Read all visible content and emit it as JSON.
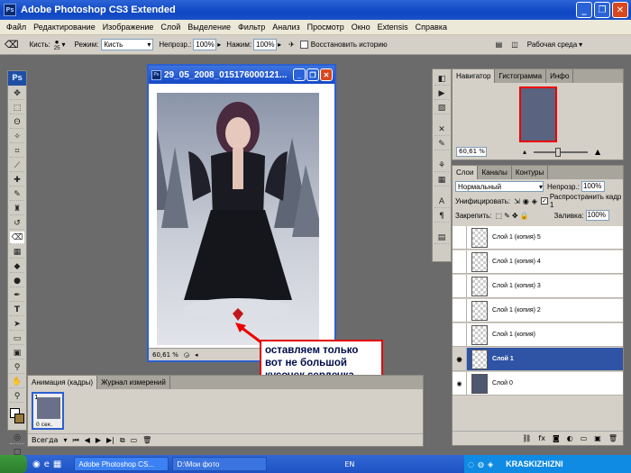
{
  "app": {
    "title": "Adobe Photoshop CS3 Extended"
  },
  "menu": [
    "Файл",
    "Редактирование",
    "Изображение",
    "Слой",
    "Выделение",
    "Фильтр",
    "Анализ",
    "Просмотр",
    "Окно",
    "Extensis",
    "Справка"
  ],
  "options": {
    "brush_label": "Кисть:",
    "brush_size": "25",
    "mode_label": "Режим:",
    "mode_value": "Кисть",
    "opacity_label": "Непрозр.:",
    "opacity_value": "100%",
    "pressure_label": "Нажим:",
    "pressure_value": "100%",
    "restore_label": "Восстановить историю",
    "workspace_label": "Рабочая среда"
  },
  "document": {
    "title": "29_05_2008_015176000121...",
    "zoom": "60,61 %"
  },
  "annotation": {
    "line1": "оставляем только",
    "line2": "вот не большой",
    "line3": "кусочек сердечка"
  },
  "animation": {
    "tab_active": "Анимация (кадры)",
    "tab_other": "Журнал измерений",
    "frame_number": "1",
    "frame_time": "0 сек.",
    "loop": "Всегда"
  },
  "navigator": {
    "tabs": [
      "Навигатор",
      "Гистограмма",
      "Инфо"
    ],
    "zoom": "60,61 %"
  },
  "layers": {
    "tabs": [
      "Слои",
      "Каналы",
      "Контуры"
    ],
    "blend_mode": "Нормальный",
    "opacity_label": "Непрозр.:",
    "opacity_value": "100%",
    "unify_label": "Унифицировать:",
    "propagate_label": "Распространить кадр 1",
    "lock_label": "Закрепить:",
    "fill_label": "Заливка:",
    "fill_value": "100%",
    "items": [
      {
        "name": "Слой 1 (копия) 5",
        "visible": false,
        "selected": false
      },
      {
        "name": "Слой 1 (копия) 4",
        "visible": false,
        "selected": false
      },
      {
        "name": "Слой 1 (копия) 3",
        "visible": false,
        "selected": false
      },
      {
        "name": "Слой 1 (копия) 2",
        "visible": false,
        "selected": false
      },
      {
        "name": "Слой 1 (копия)",
        "visible": false,
        "selected": false
      },
      {
        "name": "Слой 1",
        "visible": true,
        "selected": true
      },
      {
        "name": "Слой 0",
        "visible": true,
        "selected": false
      }
    ]
  },
  "taskbar": {
    "task1": "Adobe Photoshop CS...",
    "task2": "D:\\Мои фото",
    "lang": "EN",
    "watermark": "KRASKIZHIZNI"
  }
}
